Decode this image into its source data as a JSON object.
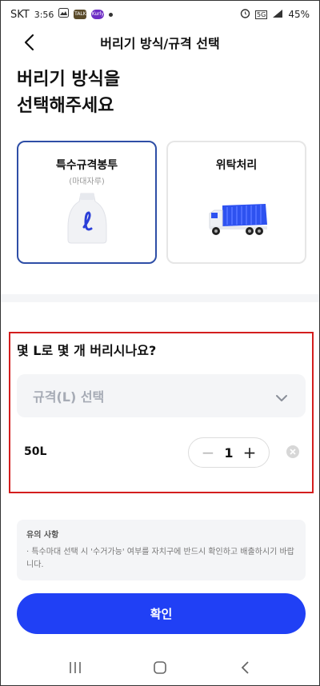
{
  "status_bar": {
    "carrier": "SKT",
    "time": "3:56",
    "talk_badge": "TALK",
    "kurly_badge": "Kurly",
    "network": "5G",
    "battery": "45%"
  },
  "header": {
    "title": "버리기 방식/규격 선택"
  },
  "page": {
    "title_line1": "버리기 방식을",
    "title_line2": "선택해주세요"
  },
  "options": [
    {
      "title": "특수규격봉투",
      "subtitle": "(마대자루)",
      "selected": true
    },
    {
      "title": "위탁처리",
      "selected": false
    }
  ],
  "question": {
    "title": "몇 L로 몇 개 버리시나요?",
    "select_placeholder": "규격(L) 선택"
  },
  "item": {
    "label": "50L",
    "quantity": "1",
    "minus": "−",
    "plus": "+"
  },
  "notice": {
    "title": "유의 사항",
    "body": "· 특수마대 선택 시 '수거가능' 여부를 자치구에 반드시 확인하고 배출하시기 바랍니다."
  },
  "confirm_label": "확인",
  "colors": {
    "accent": "#2040f5",
    "selected_border": "#2e4ea6",
    "highlight": "#d31e1e"
  }
}
